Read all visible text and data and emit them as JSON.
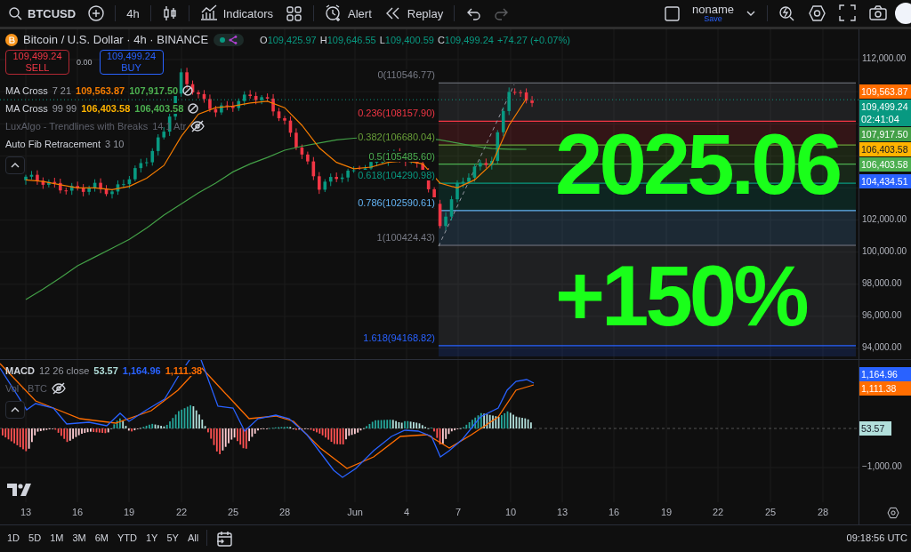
{
  "toolbar": {
    "symbol": "BTCUSD",
    "interval": "4h",
    "buttons": [
      {
        "kind": "indicators",
        "label": "Indicators"
      },
      {
        "kind": "alert",
        "label": "Alert"
      },
      {
        "kind": "replay",
        "label": "Replay"
      }
    ],
    "layout_name": "noname",
    "save": "Save"
  },
  "legend": {
    "title": "Bitcoin / U.S. Dollar · 4h · BINANCE",
    "ohlc": [
      {
        "key": "O",
        "value": "109,425.97"
      },
      {
        "key": "H",
        "value": "109,646.55"
      },
      {
        "key": "L",
        "value": "109,400.59"
      },
      {
        "key": "C",
        "value": "109,499.24"
      }
    ],
    "change": "+74.27 (+0.07%)",
    "sell": {
      "price": "109,499.24",
      "label": "SELL"
    },
    "spread": "0.00",
    "buy": {
      "price": "109,499.24",
      "label": "BUY"
    },
    "indicators": [
      {
        "name": "MA Cross",
        "params": "7 21",
        "hidden": false,
        "values": [
          {
            "text": "109,563.87",
            "color": "#f57c00"
          },
          {
            "text": "107,917.50",
            "color": "#4caf50"
          }
        ]
      },
      {
        "name": "MA Cross",
        "params": "99 99",
        "hidden": false,
        "values": [
          {
            "text": "106,403.58",
            "color": "#ffb300"
          },
          {
            "text": "106,403.58",
            "color": "#4caf50"
          }
        ]
      },
      {
        "name": "LuxAlgo - Trendlines with Breaks",
        "params": "14 1 Atr",
        "hidden": true
      },
      {
        "name": "Auto Fib Retracement",
        "params": "3 10",
        "hidden": false
      }
    ]
  },
  "fib_levels": [
    {
      "label": "0(110546.77)",
      "color": "#787b86"
    },
    {
      "label": "0.236(108157.90)",
      "color": "#f23645"
    },
    {
      "label": "0.382(106680.04)",
      "color": "#689f38"
    },
    {
      "label": "0.5(105485.60)",
      "color": "#4caf50"
    },
    {
      "label": "0.618(104290.98)",
      "color": "#089981"
    },
    {
      "label": "0.786(102590.61)",
      "color": "#64b5f6"
    },
    {
      "label": "1(100424.43)",
      "color": "#787b86"
    },
    {
      "label": "1.618(94168.82)",
      "color": "#2962ff"
    }
  ],
  "overlay_texts": [
    "2025.06",
    "+150%"
  ],
  "price_axis": [
    "112,000.00",
    "102,000.00",
    "100,000.00",
    "98,000.00",
    "96,000.00",
    "94,000.00"
  ],
  "price_badges": [
    {
      "text": "109,563.87",
      "color": "#ff6d00"
    },
    {
      "text": "109,499.24",
      "sub": "02:41:04",
      "color": "#089981"
    },
    {
      "text": "107,917.50",
      "color": "#43a047"
    },
    {
      "text": "106,403.58",
      "color": "#ffb300"
    },
    {
      "text": "106,403.58",
      "color": "#4caf50"
    },
    {
      "text": "104,434.51",
      "color": "#2962ff"
    }
  ],
  "macd": {
    "name": "MACD",
    "params": "12 26 close",
    "values": [
      {
        "text": "53.57",
        "color": "#b2dfdb"
      },
      {
        "text": "1,164.96",
        "color": "#2962ff"
      },
      {
        "text": "1,111.38",
        "color": "#ff6d00"
      }
    ],
    "volume": {
      "name": "Vol · BTC",
      "hidden": true
    },
    "axis_label": "−1,000.00",
    "badges": [
      {
        "kind": "line",
        "text": "1,164.96",
        "color": "#2962ff"
      },
      {
        "kind": "line",
        "text": "1,111.38",
        "color": "#ff6d00"
      },
      {
        "kind": "histogram",
        "text": "53.57",
        "color": "#b2dfdb"
      }
    ]
  },
  "time_axis": [
    "13",
    "16",
    "19",
    "22",
    "25",
    "28",
    "Jun",
    "4",
    "7",
    "10",
    "13",
    "16",
    "19",
    "22",
    "25",
    "28"
  ],
  "ranges": [
    "1D",
    "5D",
    "1M",
    "3M",
    "6M",
    "YTD",
    "1Y",
    "5Y",
    "All"
  ],
  "clock": "09:18:56 UTC"
}
